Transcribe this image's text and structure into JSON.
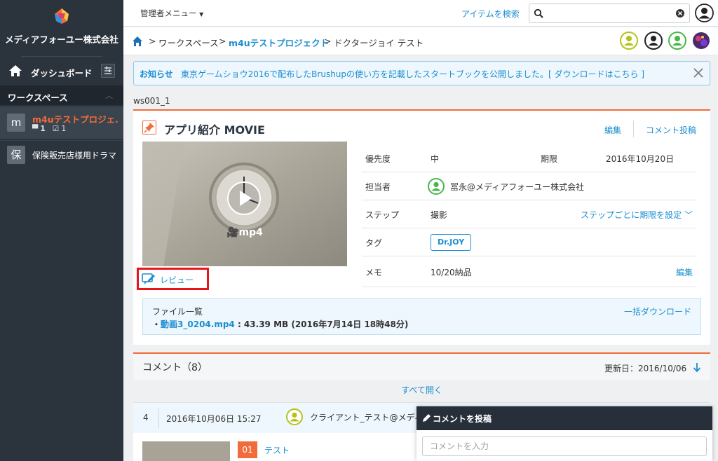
{
  "sidebar": {
    "company": "メディアフォーユー株式会社",
    "dashboard": "ダッシュボード",
    "workspace_header": "ワークスペース",
    "projects": [
      {
        "badge": "m",
        "name": "m4uテストプロジェ...",
        "comments": "1",
        "tasks": "1"
      },
      {
        "badge": "保",
        "name": "保険販売店様用ドラマ"
      }
    ]
  },
  "topbar": {
    "admin_menu": "管理者メニュー",
    "item_search": "アイテムを検索",
    "search_value": ""
  },
  "breadcrumb": {
    "separator": ">",
    "items": [
      "ワークスペース",
      "m4uテストプロジェクト",
      "ドクタージョイ テスト"
    ]
  },
  "notice": {
    "title": "お知らせ",
    "message": "東京ゲームショウ2016で配布したBrushupの使い方を記載したスタートブックを公開しました。[ ダウンロードはこちら ]"
  },
  "workspace_id": "ws001_1",
  "item": {
    "title": "アプリ紹介 MOVIE",
    "edit": "編集",
    "post_comment": "コメント投稿",
    "thumb_label": "mp4",
    "review": "レビュー",
    "props": {
      "priority_label": "優先度",
      "priority": "中",
      "due_label": "期限",
      "due": "2016年10月20日",
      "assignee_label": "担当者",
      "assignee": "冨永@メディアフォーユー株式会社",
      "step_label": "ステップ",
      "step": "撮影",
      "step_link": "ステップごとに期限を設定",
      "tag_label": "タグ",
      "tag": "Dr.JOY",
      "memo_label": "メモ",
      "memo": "10/20納品",
      "memo_edit": "編集"
    },
    "files": {
      "header": "ファイル一覧",
      "bullet": "・",
      "name": "動画3_0204.mp4",
      "info": " : 43.39 MB (2016年7月14日 18時48分)",
      "download_all": "一括ダウンロード"
    }
  },
  "comments": {
    "title": "コメント（8）",
    "updated": "更新日：2016/10/06",
    "open_all": "すべて開く",
    "first": {
      "num": "4",
      "date": "2016年10月06日 15:27",
      "author": "クライアント_テスト@メディ",
      "step_no": "01",
      "step_name": "テスト"
    }
  },
  "composer": {
    "title": "コメントを投稿",
    "placeholder": "コメントを入力"
  },
  "colors": {
    "accent": "#f26b3a",
    "link": "#1c8ed0",
    "sidebar": "#2b333c",
    "highlight": "#e8141c"
  }
}
